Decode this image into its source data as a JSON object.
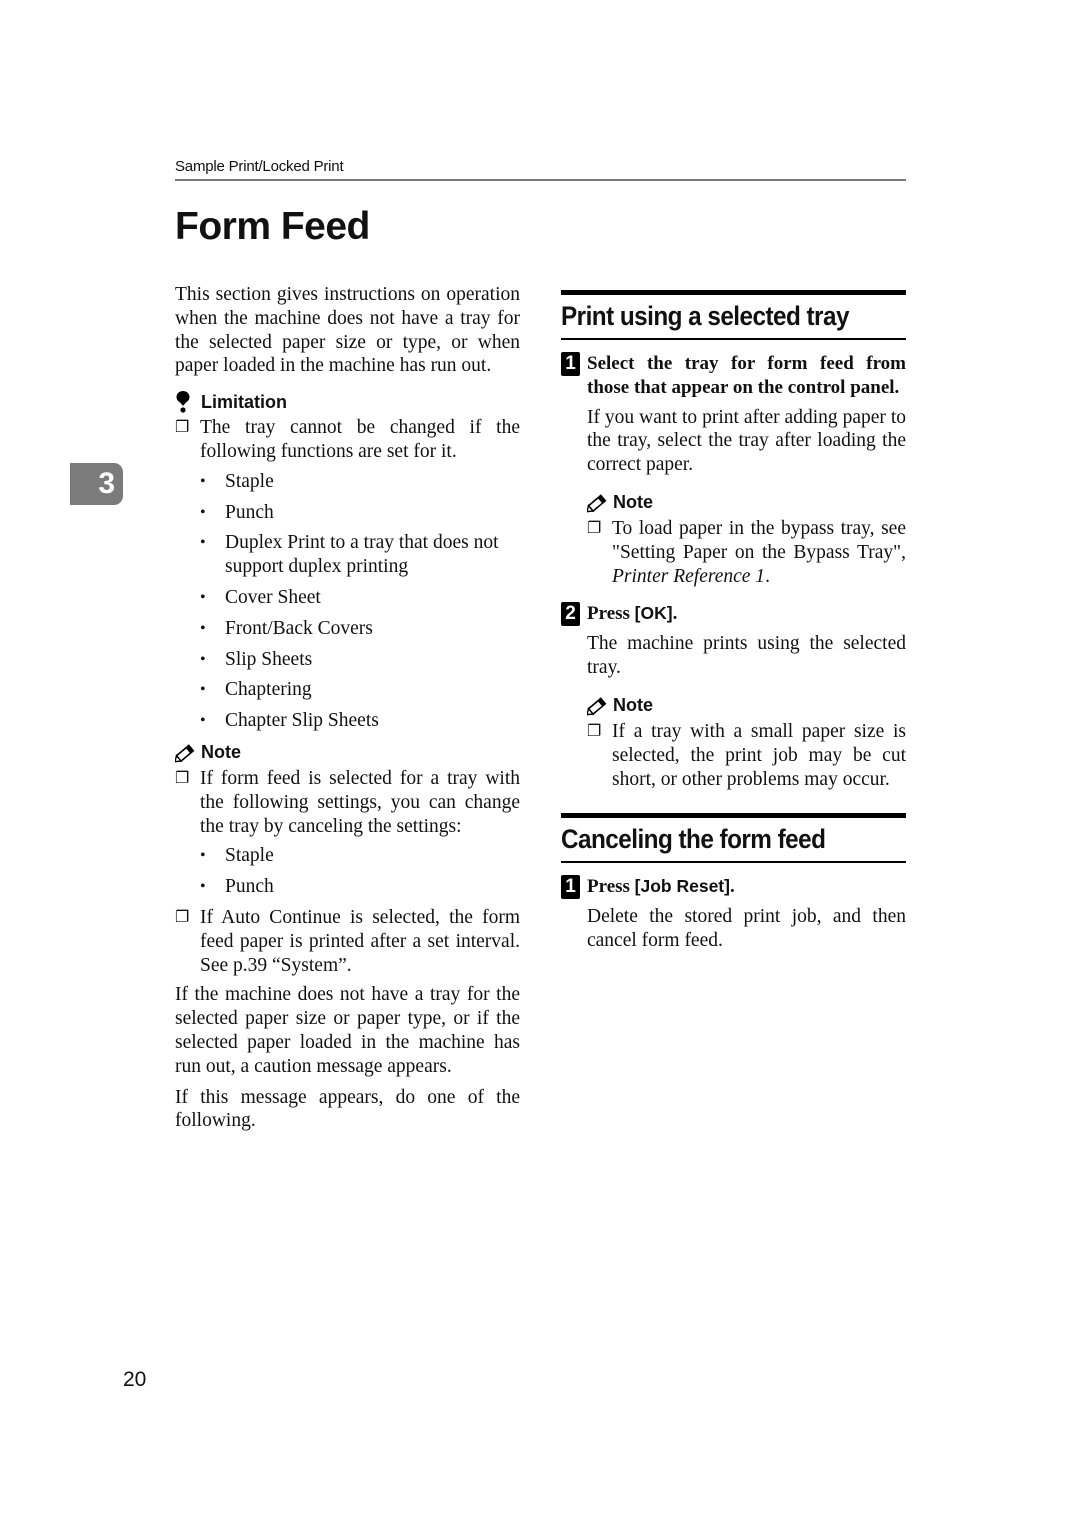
{
  "header": {
    "running_title": "Sample Print/Locked Print",
    "page_title": "Form Feed",
    "chapter_tab": "3"
  },
  "left": {
    "intro": "This section gives instructions on operation when the machine does not have a tray for the selected paper size or type, or when paper loaded in the machine has run out.",
    "limitation": {
      "icon": "limitation-icon",
      "title": "Limitation",
      "item": "The tray cannot be changed if the following functions are set for it.",
      "bullets": [
        "Staple",
        "Punch",
        "Duplex Print to a tray that does not support duplex printing",
        "Cover Sheet",
        "Front/Back Covers",
        "Slip Sheets",
        "Chaptering",
        "Chapter Slip Sheets"
      ]
    },
    "note": {
      "icon": "note-pencil-icon",
      "title": "Note",
      "item1": "If form feed is selected for a tray with the following settings, you can change the tray by canceling the settings:",
      "bullets": [
        "Staple",
        "Punch"
      ],
      "item2": "If Auto Continue is selected, the form feed paper is printed after a set interval. See p.39 “System”."
    },
    "para1": "If the machine does not have a tray for the selected paper size or paper type, or if the selected paper loaded in the machine has run out, a caution message appears.",
    "para2": "If this message appears, do one of the following."
  },
  "right": {
    "section1": {
      "title": "Print using a selected tray",
      "step1": {
        "num": "1",
        "title": "Select the tray for form feed from those that appear on the control panel.",
        "body": "If you want to print after adding paper to the tray, select the tray after loading the correct paper.",
        "note_title": "Note",
        "note_text": "To load paper in the bypass tray, see \"Setting Paper on the Bypass Tray\", ",
        "note_ref": "Printer Reference 1",
        "note_end": "."
      },
      "step2": {
        "num": "2",
        "title_prefix": "Press ",
        "key": "[OK]",
        "title_suffix": ".",
        "body": "The machine prints using the selected tray.",
        "note_title": "Note",
        "note_text": "If a tray with a small paper size is selected, the print job may be cut short, or other problems may occur."
      }
    },
    "section2": {
      "title": "Canceling the form feed",
      "step1": {
        "num": "1",
        "title_prefix": "Press ",
        "key": "[Job Reset]",
        "title_suffix": ".",
        "body": "Delete the stored print job, and then cancel form feed."
      }
    }
  },
  "footer": {
    "page_number": "20"
  }
}
